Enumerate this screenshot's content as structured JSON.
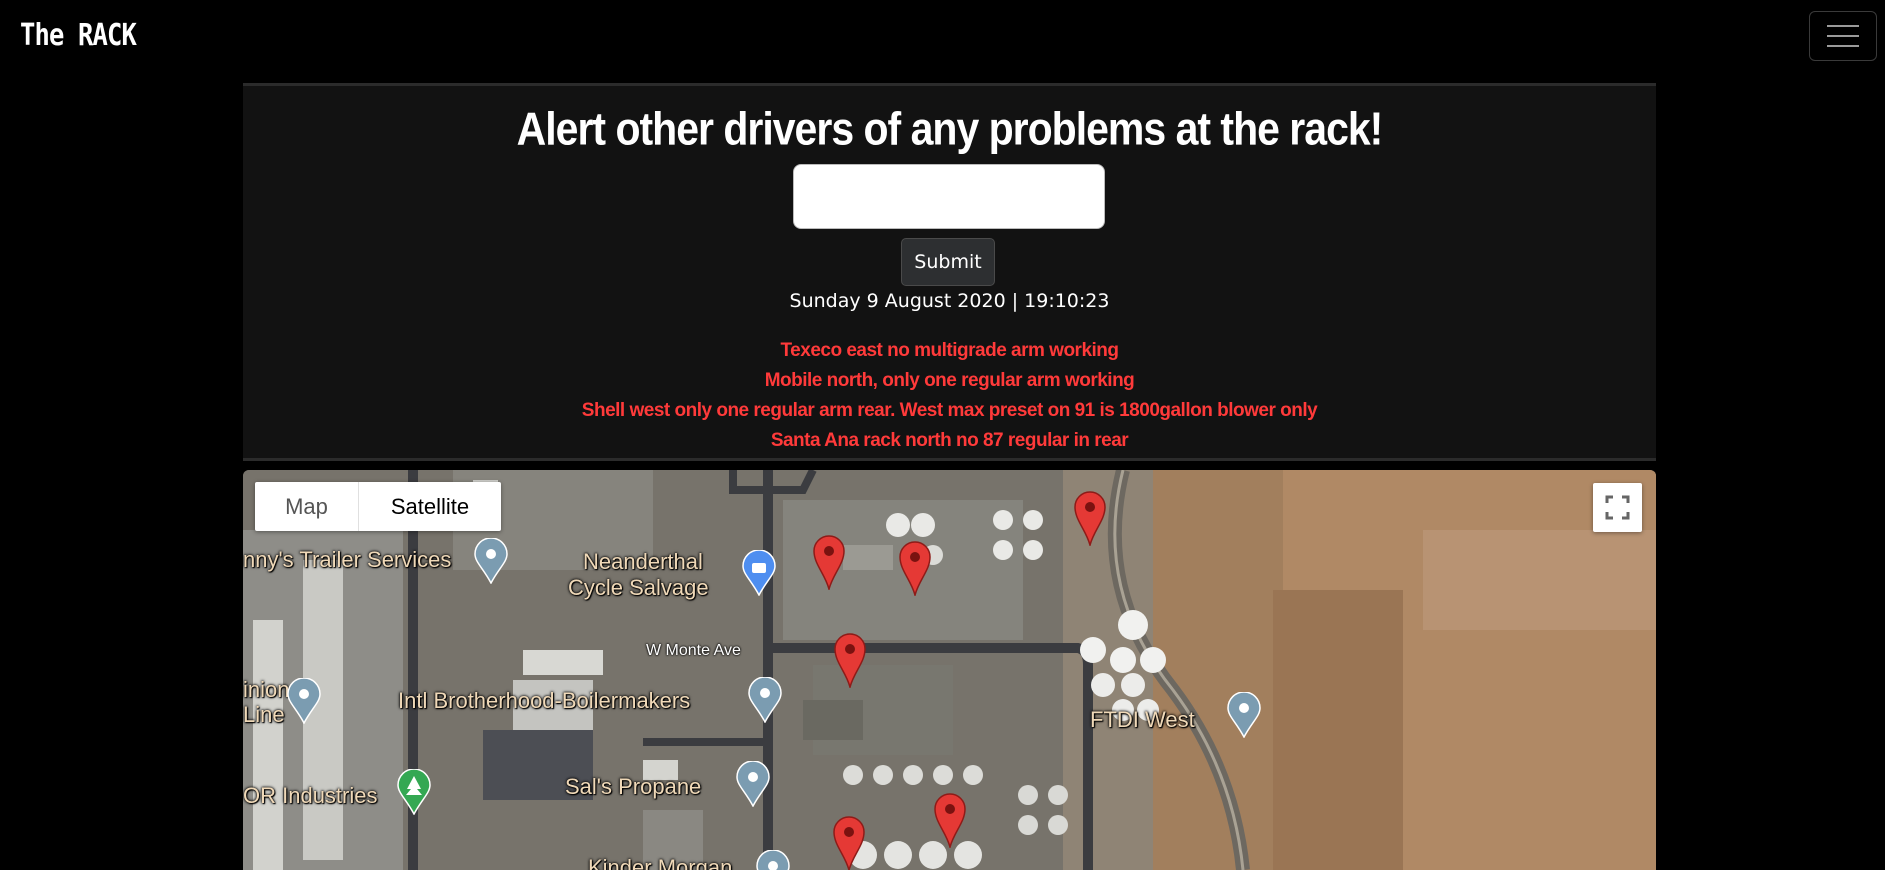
{
  "navbar": {
    "brand": "The RACK",
    "menu_icon": "hamburger-menu-icon"
  },
  "alert_form": {
    "headline": "Alert other drivers of any problems at the rack!",
    "input_value": "",
    "input_placeholder": "",
    "submit_label": "Submit",
    "datetime": "Sunday 9 August 2020 | 19:10:23"
  },
  "alerts": [
    "Texeco east no multigrade arm working",
    "Mobile north, only one regular arm working",
    "Shell west only one regular arm rear. West max preset on 91 is 1800gallon blower only",
    "Santa Ana rack north no 87 regular in rear"
  ],
  "map": {
    "type_controls": {
      "map_label": "Map",
      "satellite_label": "Satellite",
      "selected": "Satellite"
    },
    "fullscreen_icon": "fullscreen-icon",
    "places": {
      "trailer": "nny's Trailer Services",
      "neanderthal_1": "Neanderthal",
      "neanderthal_2": "Cycle Salvage",
      "union_1": "inion",
      "union_2": "Line",
      "boilermakers": "Intl Brotherhood-Boilermakers",
      "ftdi": "FTDI West",
      "industries": "OR Industries",
      "propane": "Sal's Propane",
      "kinder": "Kinder Morgan"
    },
    "streets": {
      "monte": "W Monte Ave"
    },
    "marker_color": "#e53935",
    "marker_count": 7
  },
  "colors": {
    "background": "#000000",
    "card": "#121212",
    "alert_text": "#ff3a3a"
  }
}
